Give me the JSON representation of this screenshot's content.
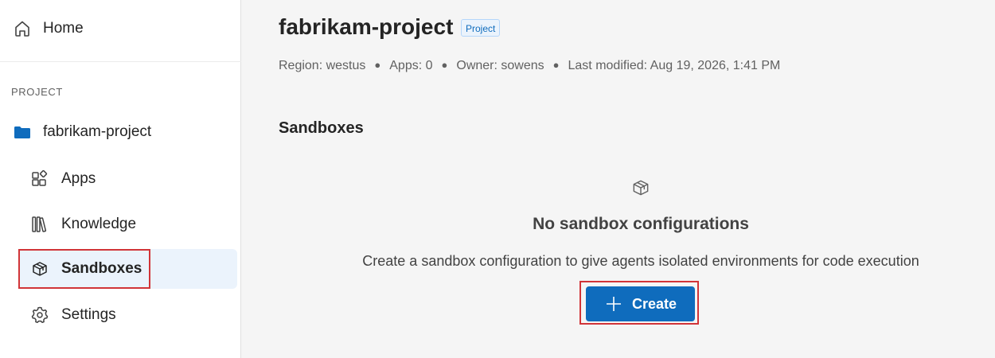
{
  "sidebar": {
    "home_label": "Home",
    "section_label": "PROJECT",
    "project_name": "fabrikam-project",
    "items": [
      {
        "label": "Apps",
        "icon": "apps-icon"
      },
      {
        "label": "Knowledge",
        "icon": "library-icon"
      },
      {
        "label": "Sandboxes",
        "icon": "cube-icon",
        "selected": true
      },
      {
        "label": "Settings",
        "icon": "gear-icon"
      }
    ]
  },
  "header": {
    "title": "fabrikam-project",
    "badge": "Project",
    "meta": {
      "region": "Region: westus",
      "apps": "Apps: 0",
      "owner": "Owner: sowens",
      "modified": "Last modified: Aug 19, 2026, 1:41 PM"
    }
  },
  "main": {
    "section_title": "Sandboxes",
    "empty_state": {
      "icon": "cube-icon",
      "title": "No sandbox configurations",
      "description": "Create a sandbox configuration to give agents isolated environments for code execution",
      "button_label": "Create"
    }
  },
  "colors": {
    "accent": "#0f6cbd",
    "selected_bg": "#ebf3fc",
    "highlight_outline": "#d13438"
  }
}
